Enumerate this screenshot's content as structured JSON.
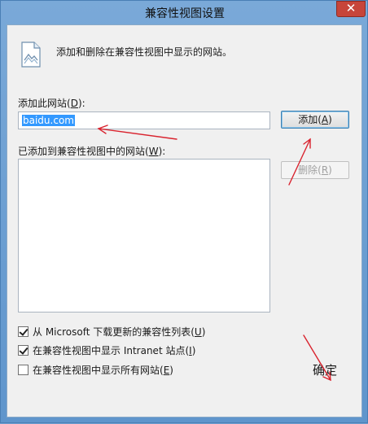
{
  "window": {
    "title": "兼容性视图设置",
    "close_glyph": "✕"
  },
  "header": {
    "icon": "web-page-icon",
    "text": "添加和删除在兼容性视图中显示的网站。"
  },
  "add_site": {
    "label_prefix": "添加此网站(",
    "label_key": "D",
    "label_suffix": "):",
    "input_value": "baidu.com",
    "add_button_prefix": "添加(",
    "add_button_key": "A",
    "add_button_suffix": ")"
  },
  "added_sites": {
    "label_prefix": "已添加到兼容性视图中的网站(",
    "label_key": "W",
    "label_suffix": "):",
    "items": [],
    "remove_button_prefix": "删除(",
    "remove_button_key": "R",
    "remove_button_suffix": ")"
  },
  "options": [
    {
      "label_prefix": "从 Microsoft 下载更新的兼容性列表(",
      "key": "U",
      "label_suffix": ")",
      "checked": true
    },
    {
      "label_prefix": "在兼容性视图中显示 Intranet 站点(",
      "key": "I",
      "label_suffix": ")",
      "checked": true
    },
    {
      "label_prefix": "在兼容性视图中显示所有网站(",
      "key": "E",
      "label_suffix": ")",
      "checked": false
    }
  ],
  "footer": {
    "ok_label": "确定"
  },
  "colors": {
    "annotation_arrow": "#d9232e",
    "selection": "#3399ff",
    "close_button": "#c7453a"
  }
}
